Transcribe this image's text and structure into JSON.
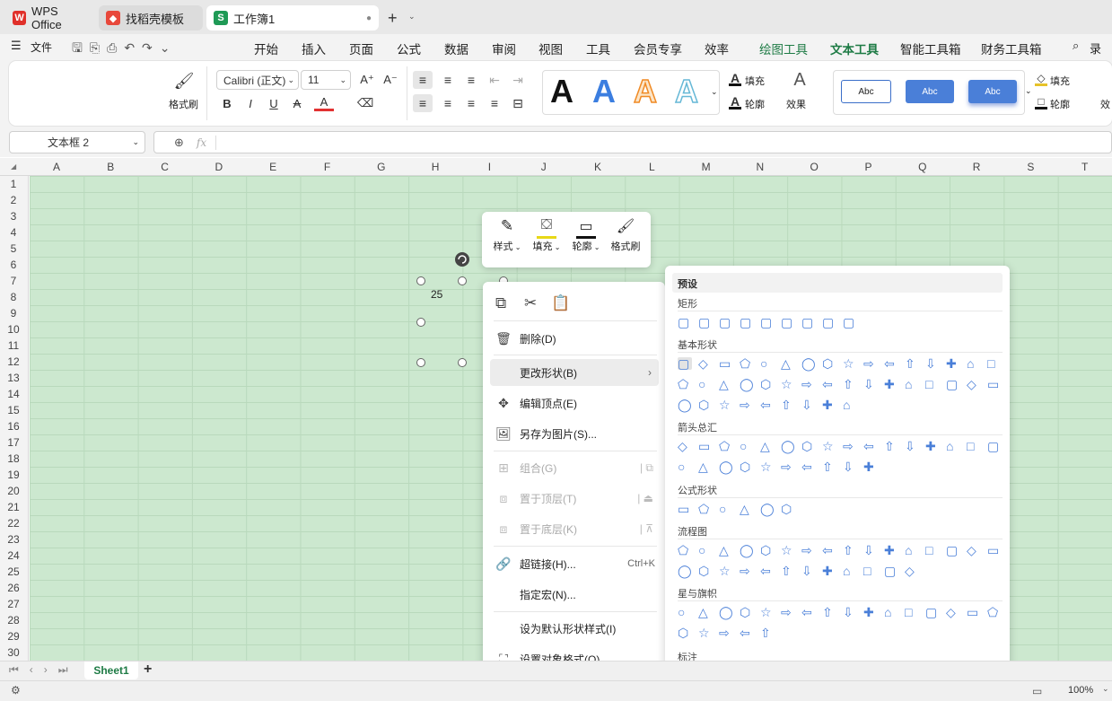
{
  "titlebar": {
    "tabs": [
      {
        "label": "WPS Office",
        "icon": "wps-logo-icon"
      },
      {
        "label": "找稻壳模板",
        "icon": "docer-icon"
      },
      {
        "label": "工作簿1",
        "icon": "spreadsheet-icon",
        "active": true
      }
    ]
  },
  "menubar": {
    "file_label": "文件",
    "tabs": [
      "开始",
      "插入",
      "页面",
      "公式",
      "数据",
      "审阅",
      "视图",
      "工具",
      "会员专享",
      "效率",
      "绘图工具",
      "文本工具",
      "智能工具箱",
      "财务工具箱"
    ],
    "active_tab": "文本工具",
    "record_label": "录屏"
  },
  "ribbon": {
    "format_painter": "格式刷",
    "font_name": "Calibri (正文)",
    "font_size": "11",
    "wordart_letter": "A",
    "fill_label": "填充",
    "outline_label": "轮廓",
    "effect_label": "效果",
    "style_sample": "Abc",
    "fill_label_2": "填充",
    "outline_label_2": "轮廓",
    "effect_label_2": "效"
  },
  "formula_bar": {
    "name_box": "文本框 2",
    "fx": "fx"
  },
  "grid": {
    "columns": [
      "A",
      "B",
      "C",
      "D",
      "E",
      "F",
      "G",
      "H",
      "I",
      "J",
      "K",
      "L",
      "M",
      "N",
      "O",
      "P",
      "Q",
      "R",
      "S",
      "T"
    ],
    "rows": [
      "1",
      "2",
      "3",
      "4",
      "5",
      "6",
      "7",
      "8",
      "9",
      "10",
      "11",
      "12",
      "13",
      "14",
      "15",
      "16",
      "17",
      "18",
      "19",
      "20",
      "21",
      "22",
      "23",
      "24",
      "25",
      "26",
      "27",
      "28",
      "29",
      "30"
    ],
    "textbox_value": "25"
  },
  "float_toolbar": {
    "items": [
      "样式",
      "填充",
      "轮廓",
      "格式刷"
    ]
  },
  "context_menu": {
    "delete": "删除(D)",
    "change_shape": "更改形状(B)",
    "edit_points": "编辑顶点(E)",
    "save_as_picture": "另存为图片(S)...",
    "group": "组合(G)",
    "bring_front": "置于顶层(T)",
    "send_back": "置于底层(K)",
    "hyperlink": "超链接(H)...",
    "hyperlink_shortcut": "Ctrl+K",
    "assign_macro": "指定宏(N)...",
    "set_default": "设为默认形状样式(I)",
    "format_object": "设置对象格式(O)..."
  },
  "shape_panel": {
    "header": "预设",
    "categories": [
      "矩形",
      "基本形状",
      "箭头总汇",
      "公式形状",
      "流程图",
      "星与旗帜",
      "标注"
    ]
  },
  "sheetbar": {
    "sheet_name": "Sheet1",
    "add": "+"
  },
  "statusbar": {
    "zoom": "100%"
  },
  "colors": {
    "accent_green": "#1e7b45",
    "cell_green": "#cce8cf",
    "shape_blue": "#4a7fd8"
  }
}
